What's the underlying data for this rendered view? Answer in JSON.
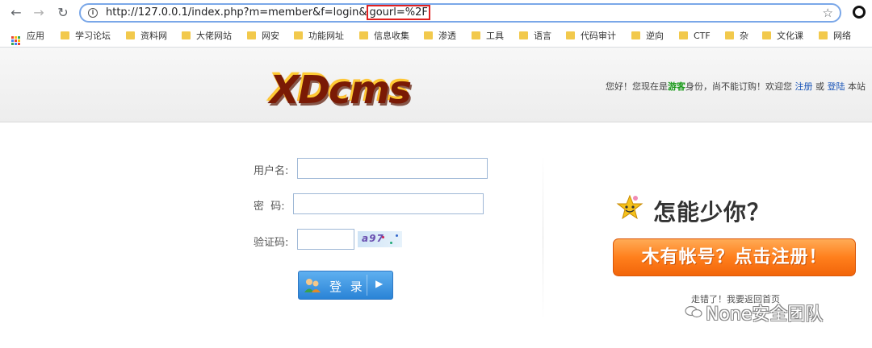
{
  "browser": {
    "url_host": "http://127.0.0.1",
    "url_path": "/index.php?m=member&f=login&",
    "url_highlight": "gourl=%2F",
    "bookmarks": [
      "应用",
      "学习论坛",
      "资料网",
      "大佬网站",
      "网安",
      "功能网址",
      "信息收集",
      "渗透",
      "工具",
      "语言",
      "代码审计",
      "逆向",
      "CTF",
      "杂",
      "文化课",
      "网络"
    ]
  },
  "header": {
    "logo": "XDcms",
    "welcome_prefix": "您好！您现在是",
    "welcome_role": "游客",
    "welcome_middle": "身份，尚不能订购！欢迎您",
    "register_link": "注册",
    "or": "或",
    "login_link": "登陆",
    "welcome_suffix": "本站"
  },
  "login": {
    "username_label": "用户名:",
    "password_label": "密  码:",
    "captcha_label": "验证码:",
    "captcha_text": "a97",
    "button_label": "登 录"
  },
  "side": {
    "prompt": "怎能少你？",
    "register_button": "木有帐号？点击注册！",
    "back_link": "走错了！我要返回首页"
  },
  "watermark": "None安全团队"
}
